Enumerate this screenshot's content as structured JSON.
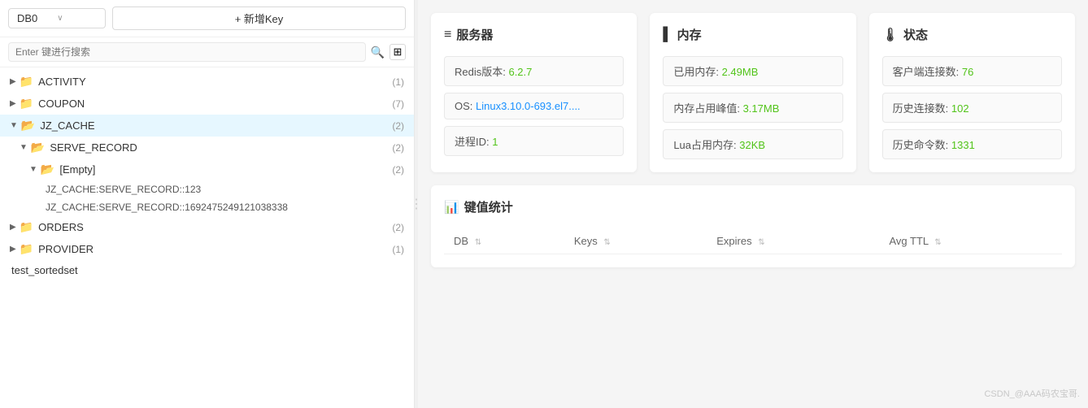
{
  "sidebar": {
    "db_select": {
      "label": "DB0",
      "arrow": "∨"
    },
    "add_key_btn": "+ 新增Key",
    "search": {
      "placeholder": "Enter 键进行搜索"
    },
    "tree": [
      {
        "id": "activity",
        "label": "ACTIVITY",
        "count": "(1)",
        "expanded": false,
        "indent": 1
      },
      {
        "id": "coupon",
        "label": "COUPON",
        "count": "(7)",
        "expanded": false,
        "indent": 1
      },
      {
        "id": "jz_cache",
        "label": "JZ_CACHE",
        "count": "(2)",
        "expanded": true,
        "active": true,
        "indent": 1
      },
      {
        "id": "serve_record",
        "label": "SERVE_RECORD",
        "count": "(2)",
        "expanded": true,
        "indent": 2
      },
      {
        "id": "empty",
        "label": "[Empty]",
        "count": "(2)",
        "expanded": true,
        "indent": 3
      },
      {
        "id": "key1",
        "label": "JZ_CACHE:SERVE_RECORD::123",
        "indent": 4,
        "isKey": true
      },
      {
        "id": "key2",
        "label": "JZ_CACHE:SERVE_RECORD::1692475249121038338",
        "indent": 4,
        "isKey": true
      },
      {
        "id": "orders",
        "label": "ORDERS",
        "count": "(2)",
        "expanded": false,
        "indent": 1
      },
      {
        "id": "provider",
        "label": "PROVIDER",
        "count": "(1)",
        "expanded": false,
        "indent": 1
      },
      {
        "id": "test_sortedset",
        "label": "test_sortedset",
        "indent": 1,
        "isKey": true,
        "noFolder": true
      }
    ]
  },
  "server_card": {
    "title": "服务器",
    "icon": "≡",
    "rows": [
      {
        "label": "Redis版本: ",
        "value": "6.2.7",
        "valueClass": "green"
      },
      {
        "label": "OS: ",
        "value": "Linux3.10.0-693.el7....",
        "valueClass": "blue"
      },
      {
        "label": "进程ID: ",
        "value": "1",
        "valueClass": "green"
      }
    ]
  },
  "memory_card": {
    "title": "内存",
    "icon": "▌",
    "rows": [
      {
        "label": "已用内存: ",
        "value": "2.49MB",
        "valueClass": "green"
      },
      {
        "label": "内存占用峰值: ",
        "value": "3.17MB",
        "valueClass": "green"
      },
      {
        "label": "Lua占用内存: ",
        "value": "32KB",
        "valueClass": "green"
      }
    ]
  },
  "status_card": {
    "title": "状态",
    "icon": "🌡",
    "rows": [
      {
        "label": "客户端连接数: ",
        "value": "76",
        "valueClass": "green"
      },
      {
        "label": "历史连接数: ",
        "value": "102",
        "valueClass": "green"
      },
      {
        "label": "历史命令数: ",
        "value": "1331",
        "valueClass": "green"
      }
    ]
  },
  "stats": {
    "title": "键值统计",
    "icon": "📊",
    "columns": [
      {
        "label": "DB",
        "sort": true
      },
      {
        "label": "Keys",
        "sort": true
      },
      {
        "label": "Expires",
        "sort": true
      },
      {
        "label": "Avg TTL",
        "sort": true
      }
    ]
  },
  "watermark": "CSDN_@AAA码农宝哥."
}
